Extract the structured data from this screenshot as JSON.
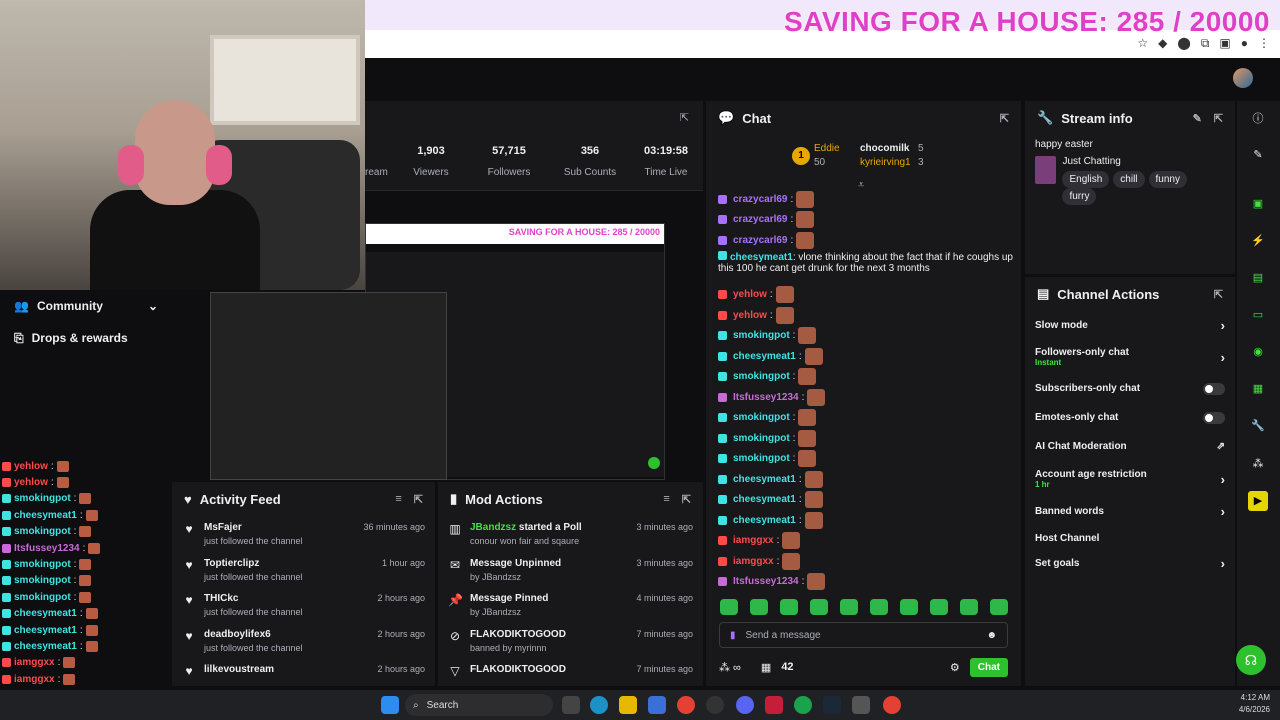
{
  "overlay": {
    "goal_text": "SAVING FOR A HOUSE: 285 / 20000"
  },
  "sidebar": {
    "items": [
      {
        "label": "Community",
        "icon": "community-icon"
      },
      {
        "label": "Drops & rewards",
        "icon": "drops-icon"
      }
    ]
  },
  "left_chat": [
    {
      "text": "yehlow",
      "color": "#ff4a4a"
    },
    {
      "text": "yehlow",
      "color": "#ff4a4a"
    },
    {
      "text": "smokingpot",
      "color": "#3fe3e3"
    },
    {
      "text": "cheesymeat1",
      "color": "#3fe3e3"
    },
    {
      "text": "smokingpot",
      "color": "#3fe3e3"
    },
    {
      "text": "Itsfussey1234",
      "color": "#c86bd6"
    },
    {
      "text": "smokingpot",
      "color": "#3fe3e3"
    },
    {
      "text": "smokingpot",
      "color": "#3fe3e3"
    },
    {
      "text": "smokingpot",
      "color": "#3fe3e3"
    },
    {
      "text": "cheesymeat1",
      "color": "#3fe3e3"
    },
    {
      "text": "cheesymeat1",
      "color": "#3fe3e3"
    },
    {
      "text": "cheesymeat1",
      "color": "#3fe3e3"
    },
    {
      "text": "iamggxx",
      "color": "#ff4a4a"
    },
    {
      "text": "iamggxx",
      "color": "#ff4a4a"
    },
    {
      "text": "Itsfussey1234",
      "color": "#c86bd6"
    }
  ],
  "stats": [
    {
      "value": "1,903",
      "label": "Viewers"
    },
    {
      "value": "57,715",
      "label": "Followers"
    },
    {
      "value": "356",
      "label": "Sub Counts"
    },
    {
      "value": "03:19:58",
      "label": "Time Live"
    }
  ],
  "stats_cut_label": "ream",
  "preview": {
    "goal_text": "SAVING FOR A HOUSE: 285 / 20000"
  },
  "activity": {
    "title": "Activity Feed",
    "items": [
      {
        "name": "MsFajer",
        "sub": "just followed the channel",
        "time": "36 minutes ago"
      },
      {
        "name": "Toptierclipz",
        "sub": "just followed the channel",
        "time": "1 hour ago"
      },
      {
        "name": "THICkc",
        "sub": "just followed the channel",
        "time": "2 hours ago"
      },
      {
        "name": "deadboylifex6",
        "sub": "just followed the channel",
        "time": "2 hours ago"
      },
      {
        "name": "lilkevoustream",
        "sub": "",
        "time": "2 hours ago"
      }
    ]
  },
  "mod": {
    "title": "Mod Actions",
    "items": [
      {
        "a": "JBandzsz",
        "b": " started a Poll",
        "sub": "conour won fair and sqaure",
        "time": "3 minutes ago"
      },
      {
        "a": "",
        "b": "Message Unpinned",
        "sub": "by JBandzsz",
        "time": "3 minutes ago"
      },
      {
        "a": "",
        "b": "Message Pinned",
        "sub": "by JBandzsz",
        "time": "4 minutes ago"
      },
      {
        "a": "",
        "b": "FLAKODIKTOGOOD",
        "sub": "banned by myrinnn",
        "time": "7 minutes ago"
      },
      {
        "a": "",
        "b": "FLAKODIKTOGOOD",
        "sub": "",
        "time": "7 minutes ago"
      }
    ]
  },
  "chat": {
    "title": "Chat",
    "hype": {
      "rank": "1",
      "user1": "Eddie",
      "count1": "50",
      "user2": "chocomilk",
      "count2": "5",
      "user3": "kyrieirving1",
      "count3": "3"
    },
    "lines": [
      {
        "user": "crazycarl69",
        "color": "#a970ff",
        "msg": ""
      },
      {
        "user": "crazycarl69",
        "color": "#a970ff",
        "msg": ""
      },
      {
        "user": "crazycarl69",
        "color": "#a970ff",
        "msg": ""
      },
      {
        "user": "cheesymeat1",
        "color": "#3fe3e3",
        "msg": "vlone thinking about the fact that if he coughs up this 100 he cant get drunk for the next 3 months"
      },
      {
        "user": "yehlow",
        "color": "#ff4a4a",
        "msg": ""
      },
      {
        "user": "yehlow",
        "color": "#ff4a4a",
        "msg": ""
      },
      {
        "user": "smokingpot",
        "color": "#3fe3e3",
        "msg": ""
      },
      {
        "user": "cheesymeat1",
        "color": "#3fe3e3",
        "msg": ""
      },
      {
        "user": "smokingpot",
        "color": "#3fe3e3",
        "msg": ""
      },
      {
        "user": "Itsfussey1234",
        "color": "#c86bd6",
        "msg": ""
      },
      {
        "user": "smokingpot",
        "color": "#3fe3e3",
        "msg": ""
      },
      {
        "user": "smokingpot",
        "color": "#3fe3e3",
        "msg": ""
      },
      {
        "user": "smokingpot",
        "color": "#3fe3e3",
        "msg": ""
      },
      {
        "user": "cheesymeat1",
        "color": "#3fe3e3",
        "msg": ""
      },
      {
        "user": "cheesymeat1",
        "color": "#3fe3e3",
        "msg": ""
      },
      {
        "user": "cheesymeat1",
        "color": "#3fe3e3",
        "msg": ""
      },
      {
        "user": "iamggxx",
        "color": "#ff4a4a",
        "msg": ""
      },
      {
        "user": "iamggxx",
        "color": "#ff4a4a",
        "msg": ""
      },
      {
        "user": "Itsfussey1234",
        "color": "#c86bd6",
        "msg": ""
      }
    ],
    "input_placeholder": "Send a message",
    "points": "42",
    "send_label": "Chat"
  },
  "stream_info": {
    "title": "Stream info",
    "stream_title": "happy easter",
    "category": "Just Chatting",
    "tags": [
      "English",
      "chill",
      "funny",
      "furry"
    ]
  },
  "channel_actions": {
    "title": "Channel Actions",
    "items": [
      {
        "label": "Slow mode",
        "sub": "",
        "control": "chevron"
      },
      {
        "label": "Followers-only chat",
        "sub": "Instant",
        "control": "chevron"
      },
      {
        "label": "Subscribers-only chat",
        "sub": "",
        "control": "toggle"
      },
      {
        "label": "Emotes-only chat",
        "sub": "",
        "control": "toggle"
      },
      {
        "label": "AI Chat Moderation",
        "sub": "",
        "control": "external"
      },
      {
        "label": "Account age restriction",
        "sub": "1 hr",
        "control": "chevron"
      },
      {
        "label": "Banned words",
        "sub": "",
        "control": "chevron"
      },
      {
        "label": "Host Channel",
        "sub": "",
        "control": "none"
      },
      {
        "label": "Set goals",
        "sub": "",
        "control": "chevron"
      }
    ]
  },
  "taskbar": {
    "search_label": "Search",
    "time": "4:12 AM",
    "date": "4/6/2026"
  }
}
